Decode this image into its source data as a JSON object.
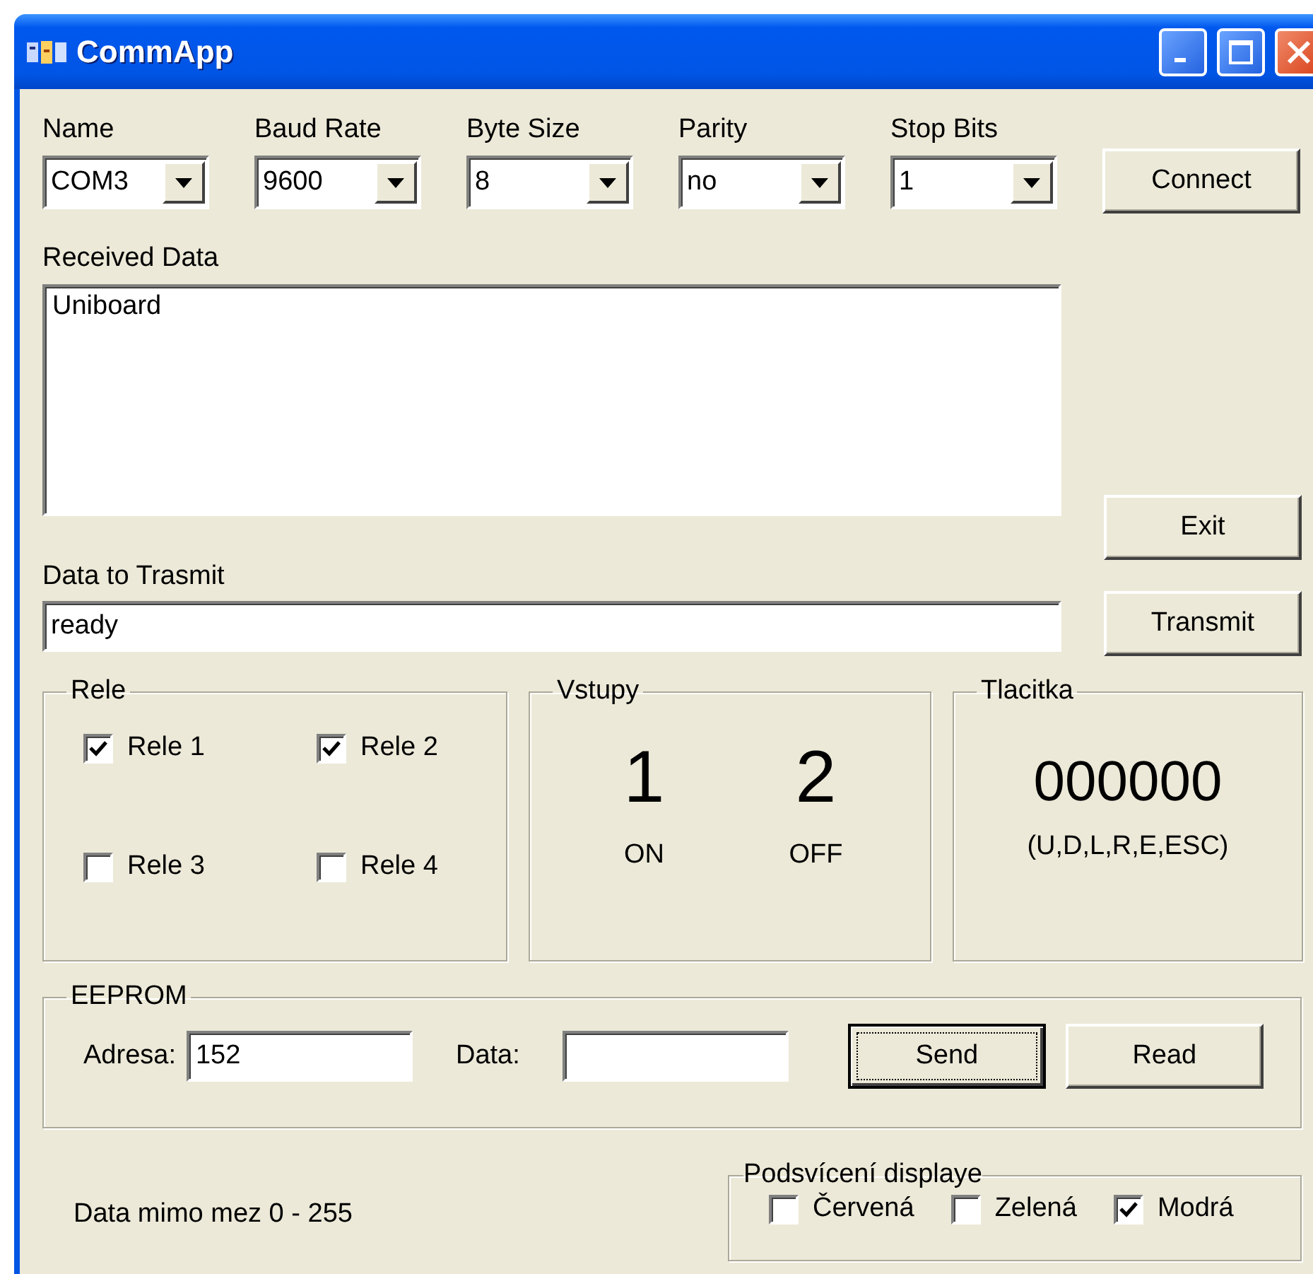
{
  "window": {
    "title": "CommApp"
  },
  "port_settings": [
    {
      "label": "Name",
      "value": "COM3"
    },
    {
      "label": "Baud Rate",
      "value": "9600"
    },
    {
      "label": "Byte Size",
      "value": "8"
    },
    {
      "label": "Parity",
      "value": "no"
    },
    {
      "label": "Stop Bits",
      "value": "1"
    }
  ],
  "connect_button": "Connect",
  "received_data": {
    "label": "Received Data",
    "text": "Uniboard"
  },
  "exit_button": "Exit",
  "transmit": {
    "label": "Data to Trasmit",
    "value": "ready",
    "button": "Transmit"
  },
  "rele": {
    "title": "Rele",
    "items": [
      {
        "label": "Rele 1",
        "checked": true
      },
      {
        "label": "Rele 2",
        "checked": true
      },
      {
        "label": "Rele 3",
        "checked": false
      },
      {
        "label": "Rele 4",
        "checked": false
      }
    ]
  },
  "vstupy": {
    "title": "Vstupy",
    "inputs": [
      {
        "number": "1",
        "state": "ON"
      },
      {
        "number": "2",
        "state": "OFF"
      }
    ]
  },
  "tlacitka": {
    "title": "Tlacitka",
    "value": "000000",
    "legend": "(U,D,L,R,E,ESC)"
  },
  "eeprom": {
    "title": "EEPROM",
    "address_label": "Adresa:",
    "address_value": "152",
    "data_label": "Data:",
    "buttons": [
      {
        "label": "Send",
        "focused": true
      },
      {
        "label": "Read",
        "focused": false
      }
    ]
  },
  "status": "Data mimo mez 0 - 255",
  "backlight": {
    "title": "Podsvícení displaye",
    "items": [
      {
        "label": "Červená",
        "checked": false
      },
      {
        "label": "Zelená",
        "checked": false
      },
      {
        "label": "Modrá",
        "checked": true
      }
    ]
  }
}
